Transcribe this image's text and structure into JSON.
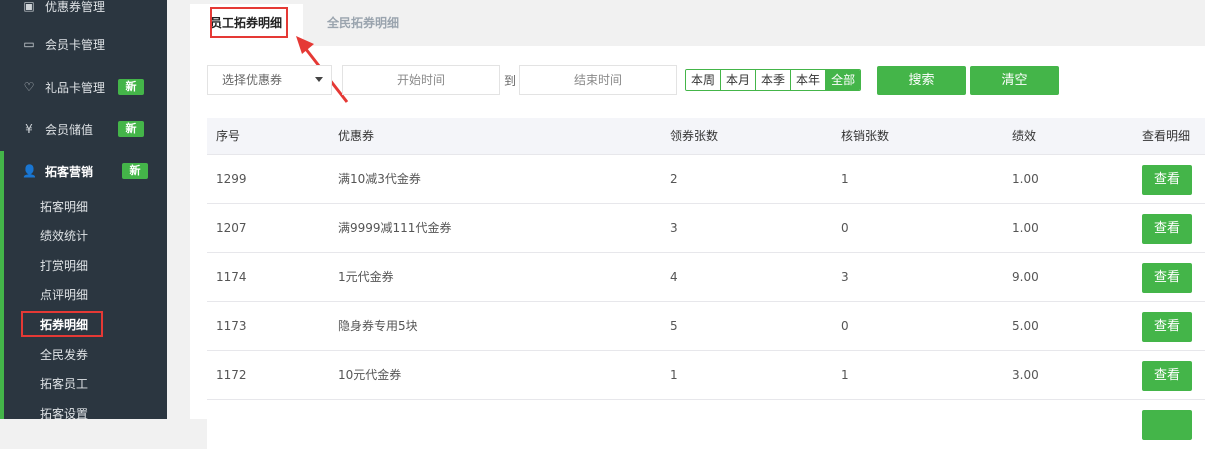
{
  "sidebar": {
    "items": [
      {
        "label": "优惠券管理",
        "icon": "coupon-icon"
      },
      {
        "label": "会员卡管理",
        "icon": "card-icon"
      },
      {
        "label": "礼品卡管理",
        "icon": "heart-icon",
        "badge": "新"
      },
      {
        "label": "会员储值",
        "icon": "yen-icon",
        "badge": "新"
      },
      {
        "label": "拓客营销",
        "icon": "person-icon",
        "badge": "新"
      }
    ],
    "sub_items": [
      "拓客明细",
      "绩效统计",
      "打赏明细",
      "点评明细",
      "拓券明细",
      "全民发券",
      "拓客员工",
      "拓客设置"
    ],
    "glyphs": {
      "coupon": "▣",
      "card": "▭",
      "heart": "♡",
      "yen": "¥",
      "person": "👤"
    }
  },
  "tabs": [
    "员工拓券明细",
    "全民拓券明细"
  ],
  "filters": {
    "select_label": "选择优惠券",
    "start_placeholder": "开始时间",
    "to_label": "到",
    "end_placeholder": "结束时间",
    "periods": [
      "本周",
      "本月",
      "本季",
      "本年",
      "全部"
    ],
    "search_label": "搜索",
    "clear_label": "清空"
  },
  "table": {
    "headers": [
      "序号",
      "优惠券",
      "领券张数",
      "核销张数",
      "绩效",
      "查看明细"
    ],
    "rows": [
      {
        "id": "1299",
        "coupon": "满10减3代金券",
        "received": "2",
        "redeemed": "1",
        "performance": "1.00"
      },
      {
        "id": "1207",
        "coupon": "满9999减111代金券",
        "received": "3",
        "redeemed": "0",
        "performance": "1.00"
      },
      {
        "id": "1174",
        "coupon": "1元代金券",
        "received": "4",
        "redeemed": "3",
        "performance": "9.00"
      },
      {
        "id": "1173",
        "coupon": "隐身券专用5块",
        "received": "5",
        "redeemed": "0",
        "performance": "5.00"
      },
      {
        "id": "1172",
        "coupon": "10元代金券",
        "received": "1",
        "redeemed": "1",
        "performance": "3.00"
      }
    ],
    "view_label": "查看"
  },
  "colors": {
    "accent": "#44b549",
    "sidebar_bg": "#2b3640",
    "highlight": "#e53935"
  }
}
